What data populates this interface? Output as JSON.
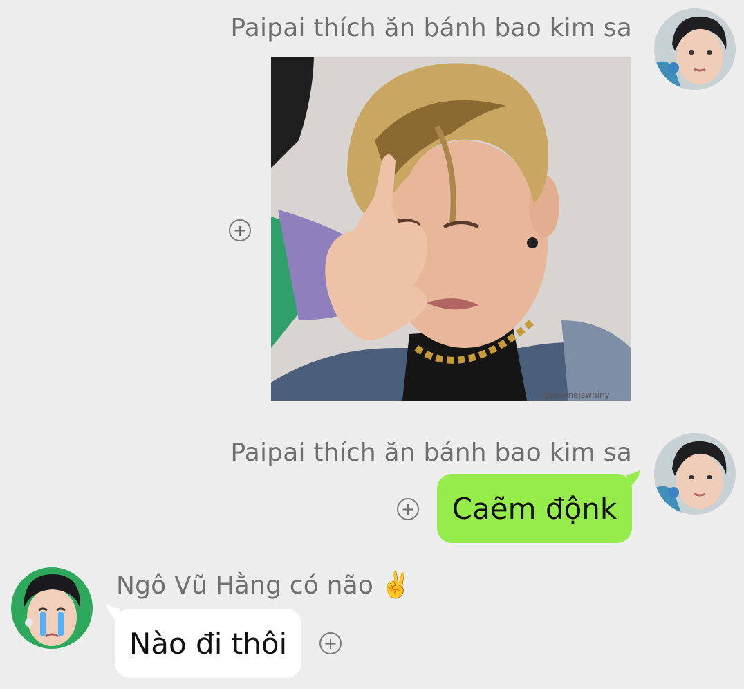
{
  "messages": [
    {
      "sender": "Paipai thích ăn bánh bao kim sa",
      "type": "image",
      "image_watermark": "@jeannejswhiny",
      "action_icon": "add-circle-icon"
    },
    {
      "sender": "Paipai thích ăn bánh bao kim sa",
      "type": "text",
      "text": "Caẽm độnk",
      "bubble_color": "#95ec4b",
      "action_icon": "add-circle-icon"
    },
    {
      "sender": "Ngô Vũ Hằng có não",
      "sender_emoji": "✌️",
      "type": "text",
      "text": "Nào đi thôi",
      "bubble_color": "#ffffff",
      "action_icon": "add-circle-icon"
    }
  ],
  "theme": {
    "background": "#ededed",
    "sent_bubble": "#95ec4b",
    "received_bubble": "#ffffff"
  }
}
